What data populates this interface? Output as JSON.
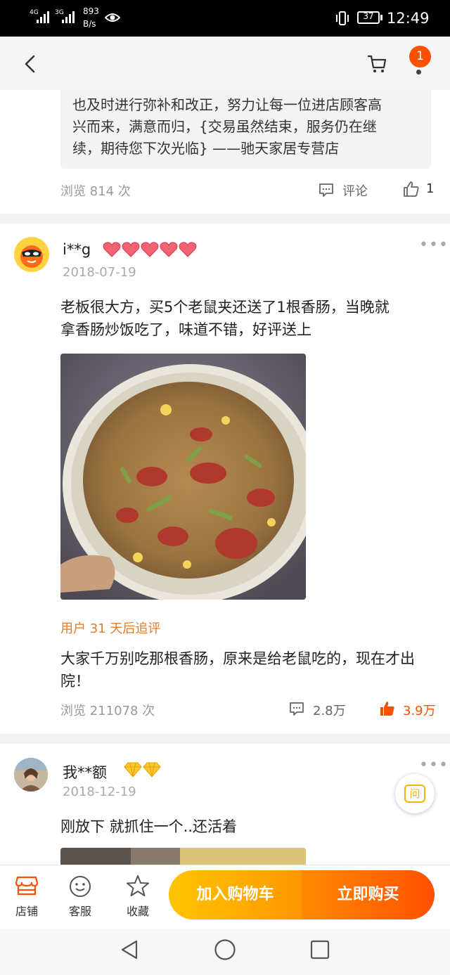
{
  "status": {
    "net1": "4G",
    "net2": "3G",
    "speed_value": "893",
    "speed_unit": "B/s",
    "battery": "37",
    "time": "12:49"
  },
  "header": {
    "badge_count": "1"
  },
  "prev_review": {
    "reply_lines": [
      "也及时进行弥补和改正，努力让每一位进店顾客高",
      "兴而来，满意而归，{交易虽然结束，服务仍在继",
      "续，期待您下次光临} ——驰天家居专营店"
    ],
    "views": "浏览 814 次",
    "comment_label": "评论",
    "like_count": "1"
  },
  "review1": {
    "username": "i**g",
    "date": "2018-07-19",
    "text_lines": [
      "老板很大方，买5个老鼠夹还送了1根香肠，当晚就",
      "拿香肠炒饭吃了，味道不错，好评送上"
    ],
    "followup_label": "用户 31 天后追评",
    "followup_lines": [
      "大家千万别吃那根香肠，原来是给老鼠吃的，现在才出",
      "院！"
    ],
    "views": "浏览 211078 次",
    "comment_count": "2.8万",
    "like_count": "3.9万"
  },
  "review2": {
    "username": "我**额",
    "date": "2018-12-19",
    "text": "刚放下 就抓住一个..还活着"
  },
  "float_button": {
    "label": "问"
  },
  "bottom_bar": {
    "shop_label": "店铺",
    "service_label": "客服",
    "favorite_label": "收藏",
    "add_cart_label": "加入购物车",
    "buy_now_label": "立即购买"
  },
  "colors": {
    "accent": "#ff5000",
    "followup": "#e07b2a",
    "cart_gradient_start": "#ffc400",
    "cart_gradient_end": "#ff9800",
    "buy_gradient_start": "#ff8a00",
    "buy_gradient_end": "#ff5000"
  }
}
